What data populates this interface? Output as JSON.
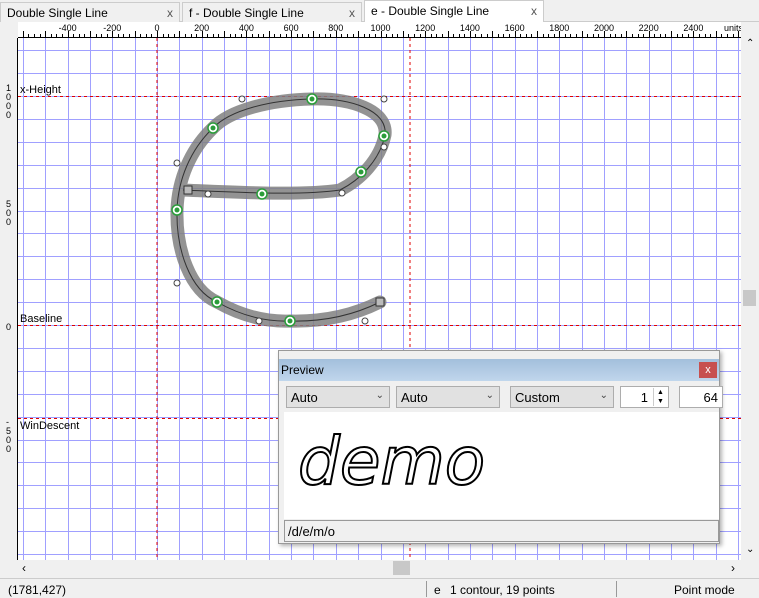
{
  "tabs": [
    {
      "label": "Double Single Line",
      "active": false
    },
    {
      "label": "f - Double Single Line",
      "active": false
    },
    {
      "label": "e - Double Single Line",
      "active": true
    }
  ],
  "close_glyph": "x",
  "ruler": {
    "h_labels": [
      "-400",
      "-200",
      "0",
      "200",
      "400",
      "600",
      "800",
      "1000",
      "1200",
      "1400",
      "1600",
      "1800",
      "2000",
      "2200",
      "2400"
    ],
    "units": "units",
    "v_labels": [
      "1000",
      "500",
      "0",
      "-500"
    ]
  },
  "guides": {
    "x_height": "x-Height",
    "baseline": "Baseline",
    "win_descent": "WinDescent"
  },
  "colors": {
    "grid": "#a0a0ff",
    "guide": "#e00000",
    "outline": "#808080",
    "point": "#2a9d3a"
  },
  "glyph": {
    "name": "e",
    "contours": 1,
    "points": 19
  },
  "preview": {
    "title": "Preview",
    "close": "x",
    "select1": "Auto",
    "select2": "Auto",
    "select3": "Custom",
    "spin_value": "1",
    "size_value": "64",
    "sample_text": "demo",
    "path": "/d/e/m/o"
  },
  "status": {
    "coords": "(1781,427)",
    "glyph": "e",
    "info": "1 contour, 19 points",
    "mode": "Point mode"
  }
}
